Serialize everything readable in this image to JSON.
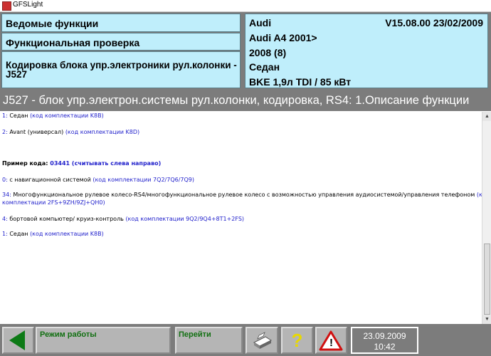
{
  "window": {
    "title": "GFSLight"
  },
  "header": {
    "left": [
      "Ведомые функции",
      "Функциональная проверка",
      "Кодировка блока упр.электроники рул.колонки -J527"
    ],
    "vehicle": {
      "make": "Audi",
      "version": "V15.08.00 23/02/2009",
      "model": "Audi A4 2001>",
      "year": "2008 (8)",
      "body": "Седан",
      "engine": "BKE  1,9л TDI / 85 кВт"
    }
  },
  "headline": "J527 - блок упр.электрон.системы рул.колонки, кодировка, RS4: 1.Описание функции",
  "content": {
    "l1_code": "1:",
    "l1_text": " Седан ",
    "l1_link": "(код комплектации K8B)",
    "l2_code": "2:",
    "l2_text": " Avant (универсал) ",
    "l2_link": "(код комплектации K8D)",
    "example_label": "Пример кода: ",
    "example_code": "03441",
    "example_note": "  (считывать слева направо)",
    "e1_code": "0:",
    "e1_text": " с навигационной системой ",
    "e1_link": "(код комплектации 7Q2/7Q6/7Q9)",
    "e2_code": "34:",
    "e2_text": " Многофункциональное рулевое колесо-RS4/многофункциональное рулевое колесо с возможностью управления аудиосистемой/управления телефоном ",
    "e2_link1": "(код",
    "e2_link2": "комплектации 2FS+9ZH/9ZJ+QH0)",
    "e3_code": "4:",
    "e3_text": " бортовой компьютер/ круиз-контроль ",
    "e3_link": "(код комплектации 9Q2/9Q4+8T1+2FS)",
    "e4_code": "1:",
    "e4_text": " Седан ",
    "e4_link": "(код комплектации K8B)"
  },
  "footer": {
    "mode_label": "Режим работы",
    "go_label": "Перейти",
    "help_symbol": "?",
    "warn_symbol": "!",
    "date": "23.09.2009",
    "time": "10:42"
  },
  "colors": {
    "header_bg": "#7c7c7c",
    "cell_bg": "#bfeefb",
    "link": "#2222cc",
    "button_label": "#127012"
  }
}
